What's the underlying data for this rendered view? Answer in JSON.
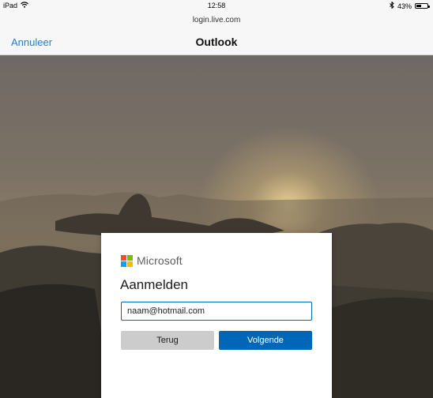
{
  "status": {
    "device": "iPad",
    "time": "12:58",
    "battery_percent": "43%",
    "battery_level": 0.43
  },
  "nav": {
    "url": "login.live.com",
    "cancel_label": "Annuleer",
    "title": "Outlook"
  },
  "login": {
    "brand": "Microsoft",
    "logo_colors": [
      "#f25022",
      "#7fba00",
      "#00a4ef",
      "#ffb900"
    ],
    "heading": "Aanmelden",
    "email_value": "naam@hotmail.com",
    "back_label": "Terug",
    "next_label": "Volgende"
  },
  "colors": {
    "accent": "#0067b8",
    "link": "#2a7bd6"
  }
}
